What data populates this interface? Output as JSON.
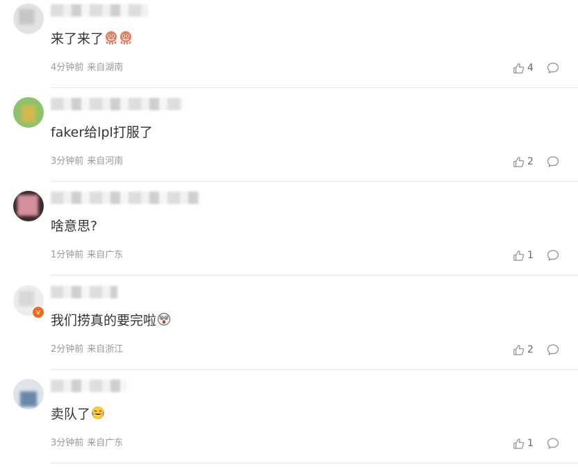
{
  "comments": [
    {
      "text": "来了来了",
      "emojis": [
        "octopus-emoji",
        "octopus-emoji"
      ],
      "time": "4分钟前",
      "location": "来自湖南",
      "likes": "4",
      "avatar_color": "#e3e3e3",
      "verified": false
    },
    {
      "text": "faker给lpl打服了",
      "emojis": [],
      "time": "3分钟前",
      "location": "来自河南",
      "likes": "2",
      "avatar_color": "#8fc36b",
      "verified": false
    },
    {
      "text": "啥意思?",
      "emojis": [],
      "time": "1分钟前",
      "location": "来自广东",
      "likes": "1",
      "avatar_color": "#e79aa8",
      "verified": false
    },
    {
      "text": "我们捞真的要完啦",
      "emojis": [
        "frightened-face-emoji"
      ],
      "time": "2分钟前",
      "location": "来自浙江",
      "likes": "2",
      "avatar_color": "#ededed",
      "verified": true,
      "verified_badge": "v"
    },
    {
      "text": "卖队了",
      "emojis": [
        "laughing-tears-emoji"
      ],
      "time": "3分钟前",
      "location": "来自广东",
      "likes": "1",
      "avatar_color": "#5d7da5",
      "verified": false
    }
  ],
  "colors": {
    "comment_text": "#333333",
    "meta_text": "#999999",
    "icon_gray": "#8f8f8f",
    "divider": "#e6e6e6",
    "verify_orange": "#f06b1c"
  }
}
